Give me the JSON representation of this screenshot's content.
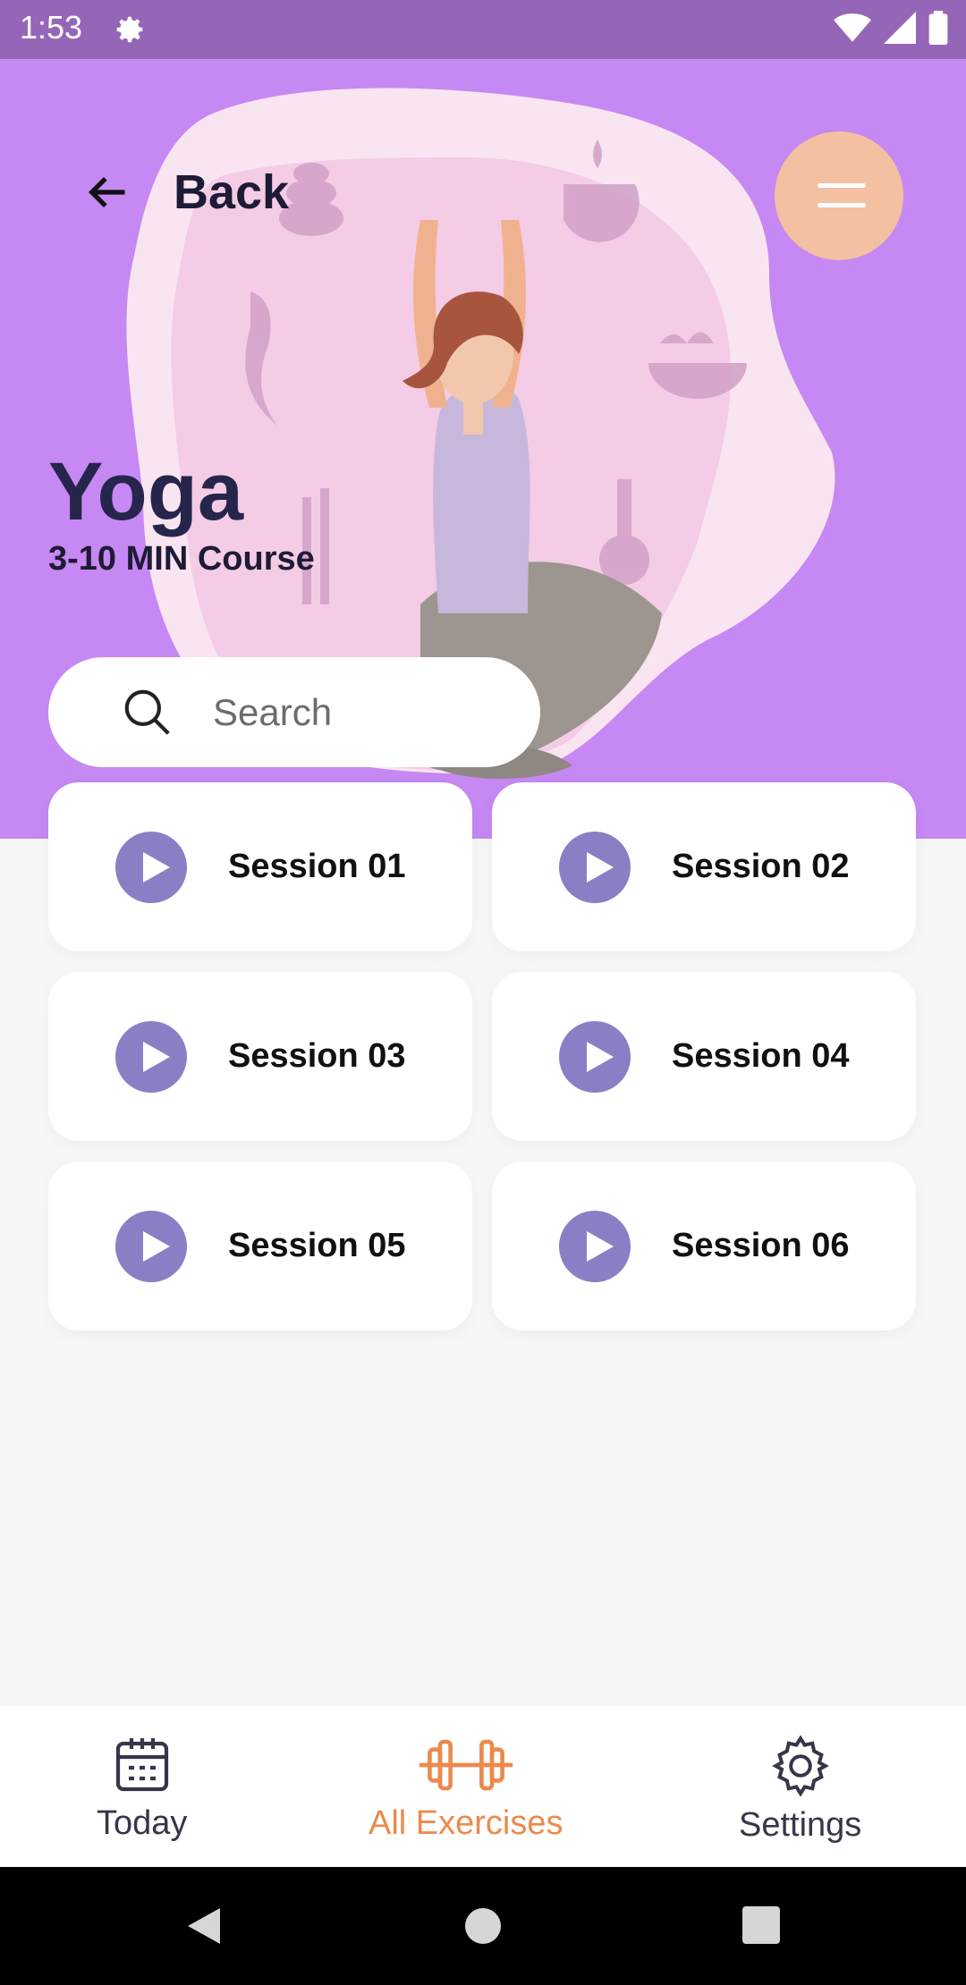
{
  "status": {
    "time": "1:53",
    "icons": [
      "gear-icon",
      "wifi-icon",
      "signal-icon",
      "battery-icon"
    ]
  },
  "header": {
    "back_label": "Back",
    "menu_icon": "menu-icon"
  },
  "course": {
    "title": "Yoga",
    "subtitle": "3-10 MIN Course"
  },
  "search": {
    "placeholder": "Search"
  },
  "sessions": [
    "Session 01",
    "Session 02",
    "Session 03",
    "Session 04",
    "Session 05",
    "Session 06"
  ],
  "tabs": [
    {
      "label": "Today",
      "icon": "calendar-icon",
      "active": false
    },
    {
      "label": "All Exercises",
      "icon": "dumbbell-icon",
      "active": true
    },
    {
      "label": "Settings",
      "icon": "gear-icon",
      "active": false
    }
  ],
  "colors": {
    "hero": "#c688f3",
    "accent": "#eb8a4c",
    "play": "#8a7fc5",
    "menu": "#f3c0a2",
    "title": "#26254c"
  }
}
